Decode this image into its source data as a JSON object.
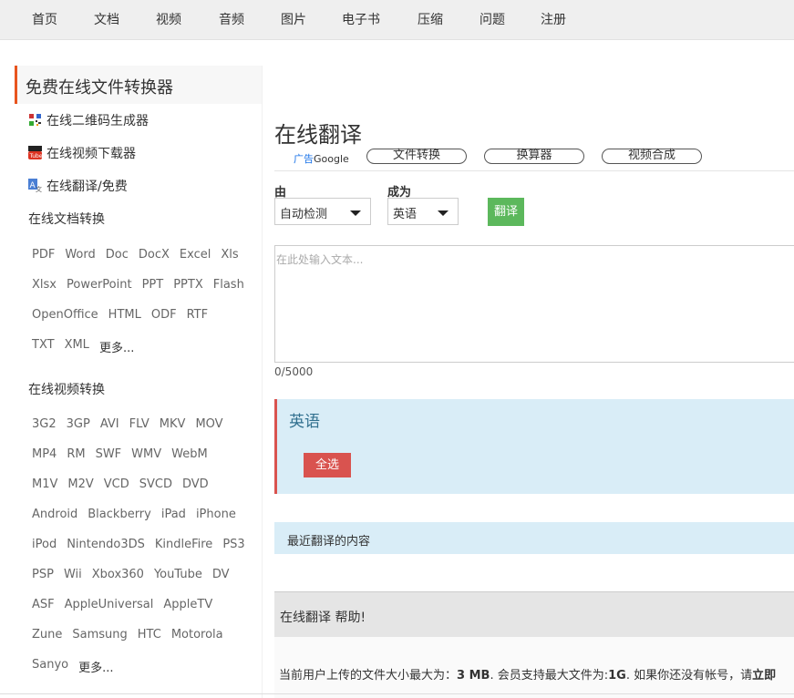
{
  "nav": [
    "首页",
    "文档",
    "视频",
    "音频",
    "图片",
    "电子书",
    "压缩",
    "问题",
    "注册"
  ],
  "sidebar": {
    "title": "免费在线文件转换器",
    "tools": [
      {
        "label": "在线二维码生成器",
        "icon": "qr-code-icon"
      },
      {
        "label": "在线视频下载器",
        "icon": "youtube-icon"
      },
      {
        "label": "在线翻译/免费",
        "icon": "translate-icon"
      }
    ],
    "doc_title": "在线文档转换",
    "doc_rows": [
      [
        "PDF",
        "Word",
        "Doc",
        "DocX",
        "Excel",
        "Xls"
      ],
      [
        "Xlsx",
        "PowerPoint",
        "PPT",
        "PPTX",
        "Flash"
      ],
      [
        "OpenOffice",
        "HTML",
        "ODF",
        "RTF"
      ],
      [
        "TXT",
        "XML",
        "更多..."
      ]
    ],
    "video_title": "在线视频转换",
    "video_rows": [
      [
        "3G2",
        "3GP",
        "AVI",
        "FLV",
        "MKV",
        "MOV"
      ],
      [
        "MP4",
        "RM",
        "SWF",
        "WMV",
        "WebM"
      ],
      [
        "M1V",
        "M2V",
        "VCD",
        "SVCD",
        "DVD"
      ],
      [
        "Android",
        "Blackberry",
        "iPad",
        "iPhone"
      ],
      [
        "iPod",
        "Nintendo3DS",
        "KindleFire",
        "PS3"
      ],
      [
        "PSP",
        "Wii",
        "Xbox360",
        "YouTube",
        "DV"
      ],
      [
        "ASF",
        "AppleUniversal",
        "AppleTV"
      ],
      [
        "Zune",
        "Samsung",
        "HTC",
        "Motorola"
      ],
      [
        "Sanyo",
        "更多..."
      ]
    ]
  },
  "main": {
    "title": "在线翻译",
    "ad_tag": "广告",
    "ad_brand": "Google",
    "tabs": [
      "文件转换",
      "换算器",
      "视频合成"
    ],
    "from_label": "由",
    "from_value": "自动检测",
    "to_label": "成为",
    "to_value": "英语",
    "translate_button": "翻译",
    "input_placeholder": "在此处输入文本...",
    "counter": "0/5000",
    "result_lang": "英语",
    "select_all": "全选",
    "recent_title": "最近翻译的内容",
    "help_title": "在线翻译 帮助!",
    "help_pre": "当前用户上传的文件大小最大为：",
    "help_size": "3 MB",
    "help_mid": ". 会员支持最大文件为:",
    "help_member_size": "1G",
    "help_post": ". 如果你还没有帐号，请",
    "help_link": "立即"
  },
  "colors": {
    "accent": "#e8541e",
    "green": "#5cb85c",
    "red": "#d9534f",
    "info_bg": "#d9edf7"
  }
}
